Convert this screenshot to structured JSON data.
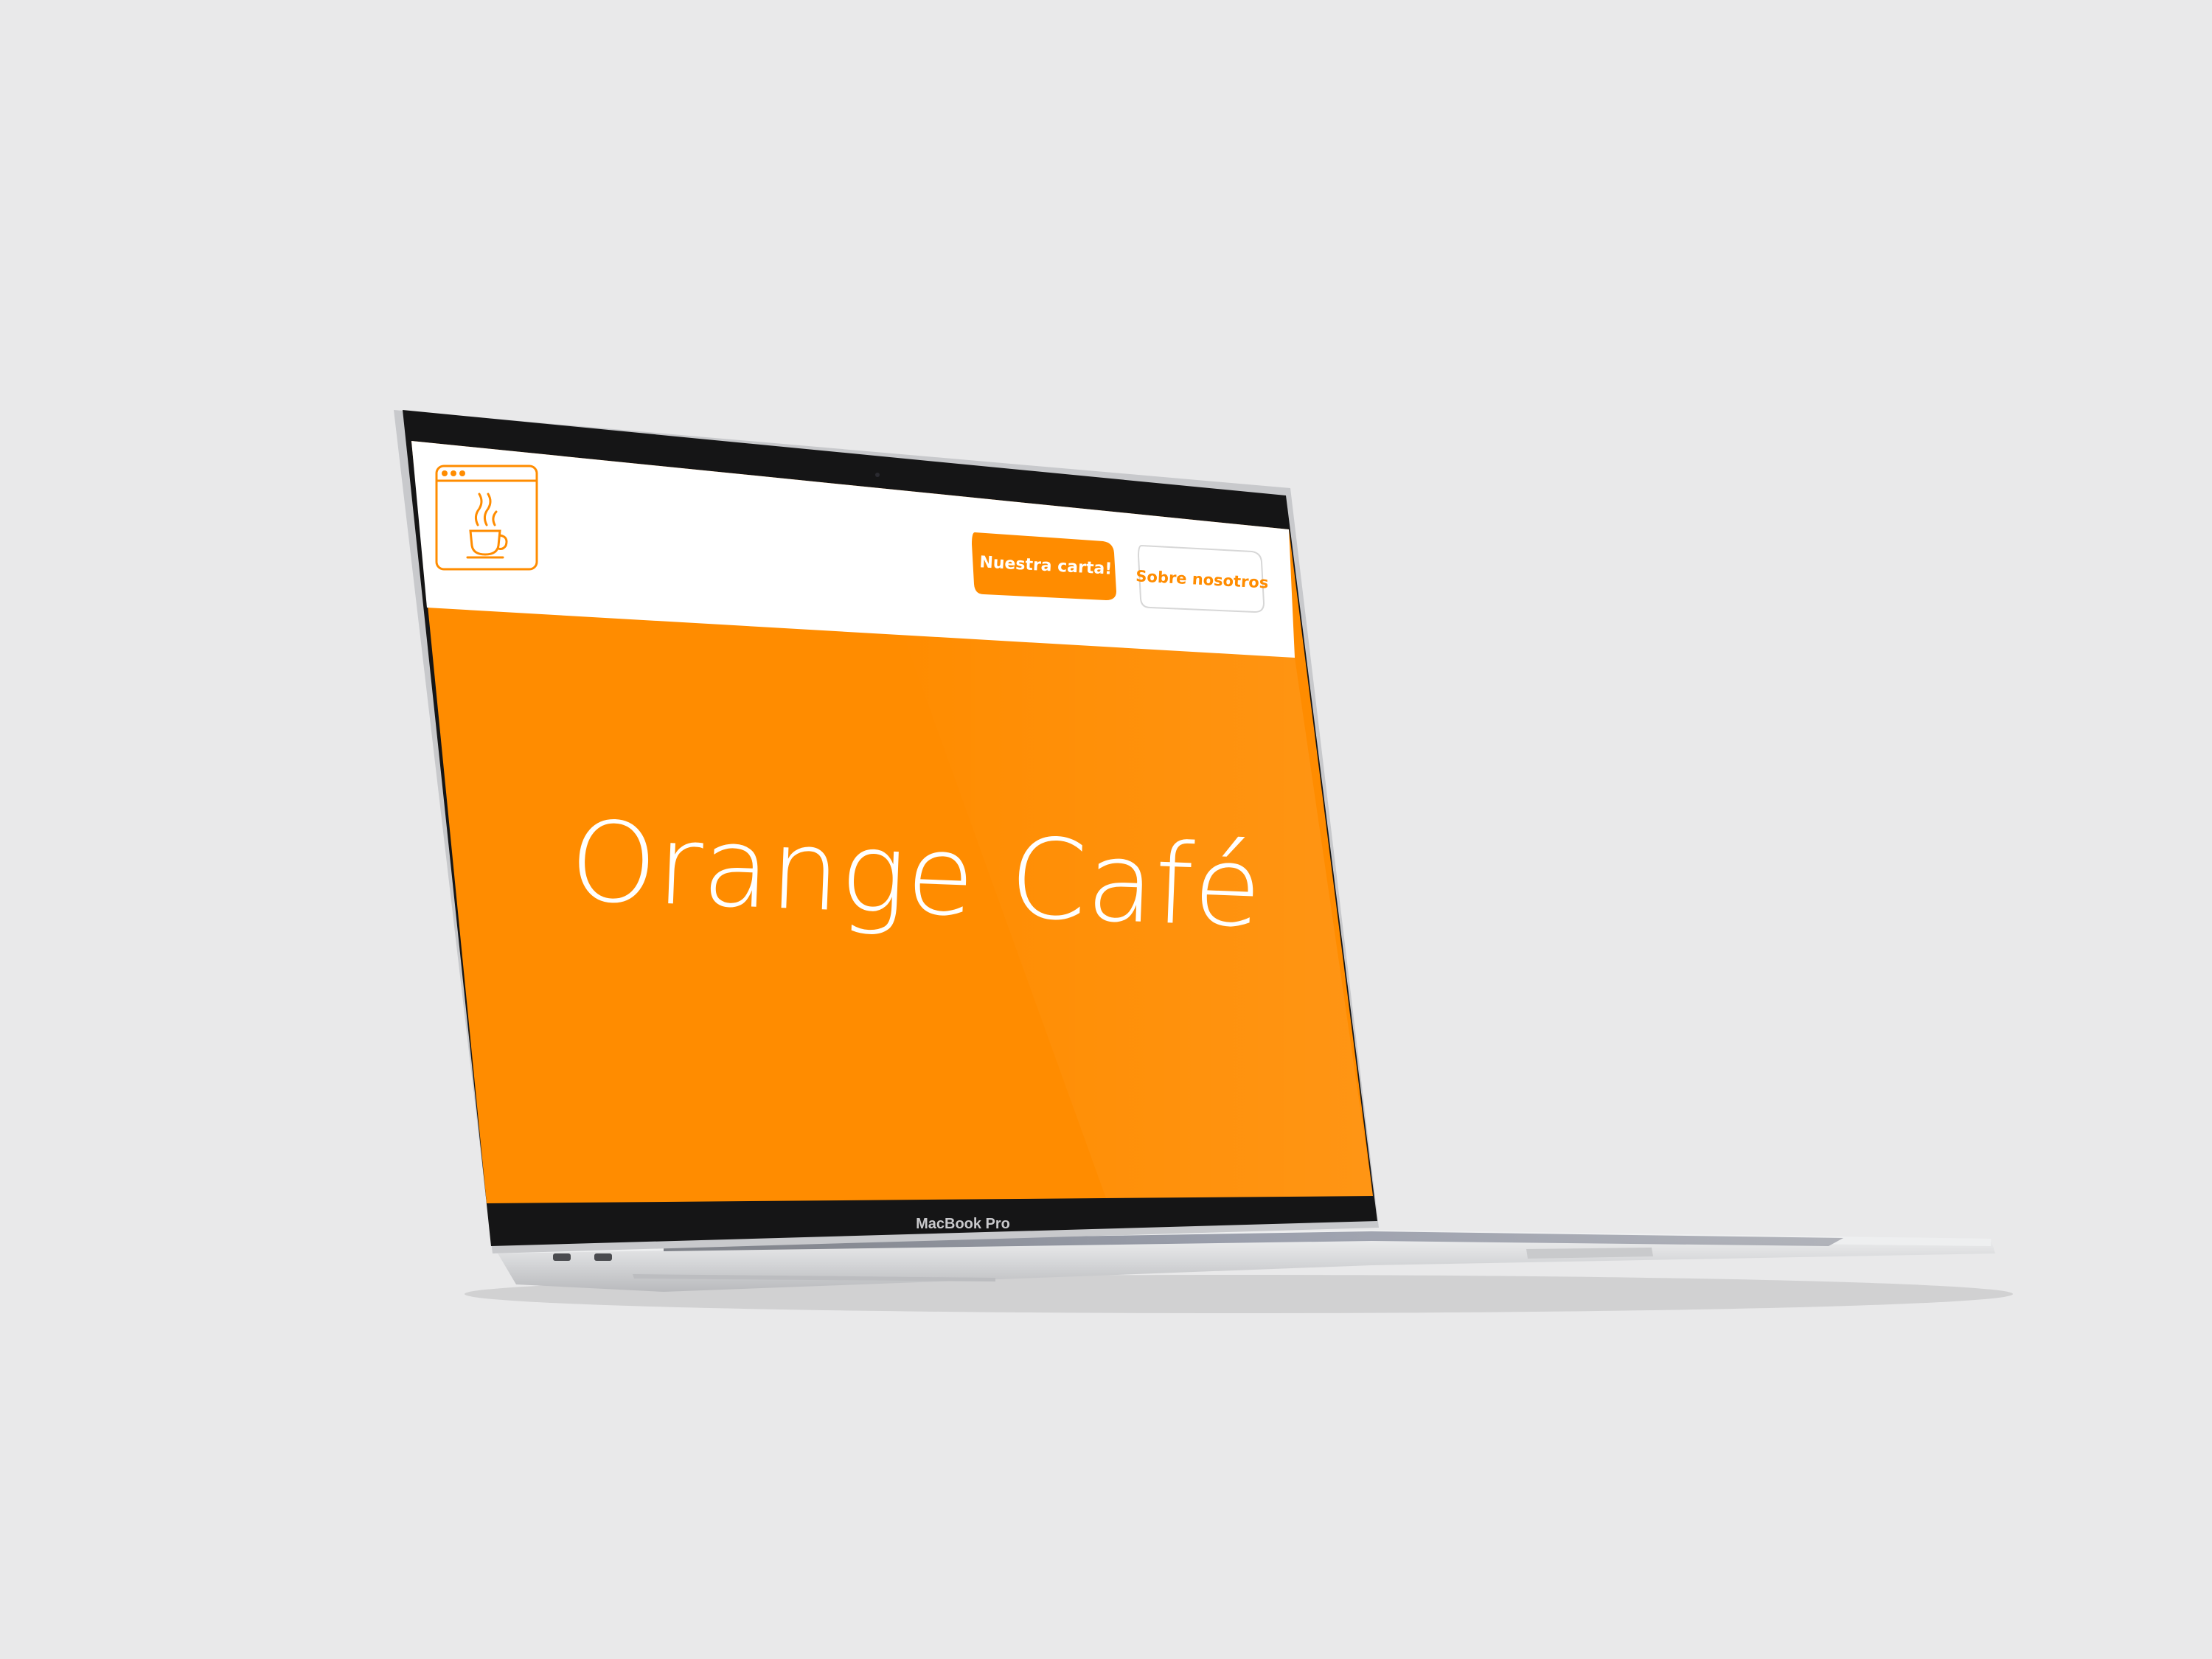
{
  "site": {
    "hero_title": "Orange Café",
    "nav": {
      "primary_button_label": "Nuestra carta!",
      "secondary_button_label": "Sobre nosotros"
    },
    "logo_icon": "coffee-cup-browser-icon"
  },
  "device": {
    "brand_label": "MacBook Pro"
  },
  "colors": {
    "accent": "#ff8c00",
    "header_bg": "#ffffff",
    "page_bg": "#e9e9ea"
  }
}
